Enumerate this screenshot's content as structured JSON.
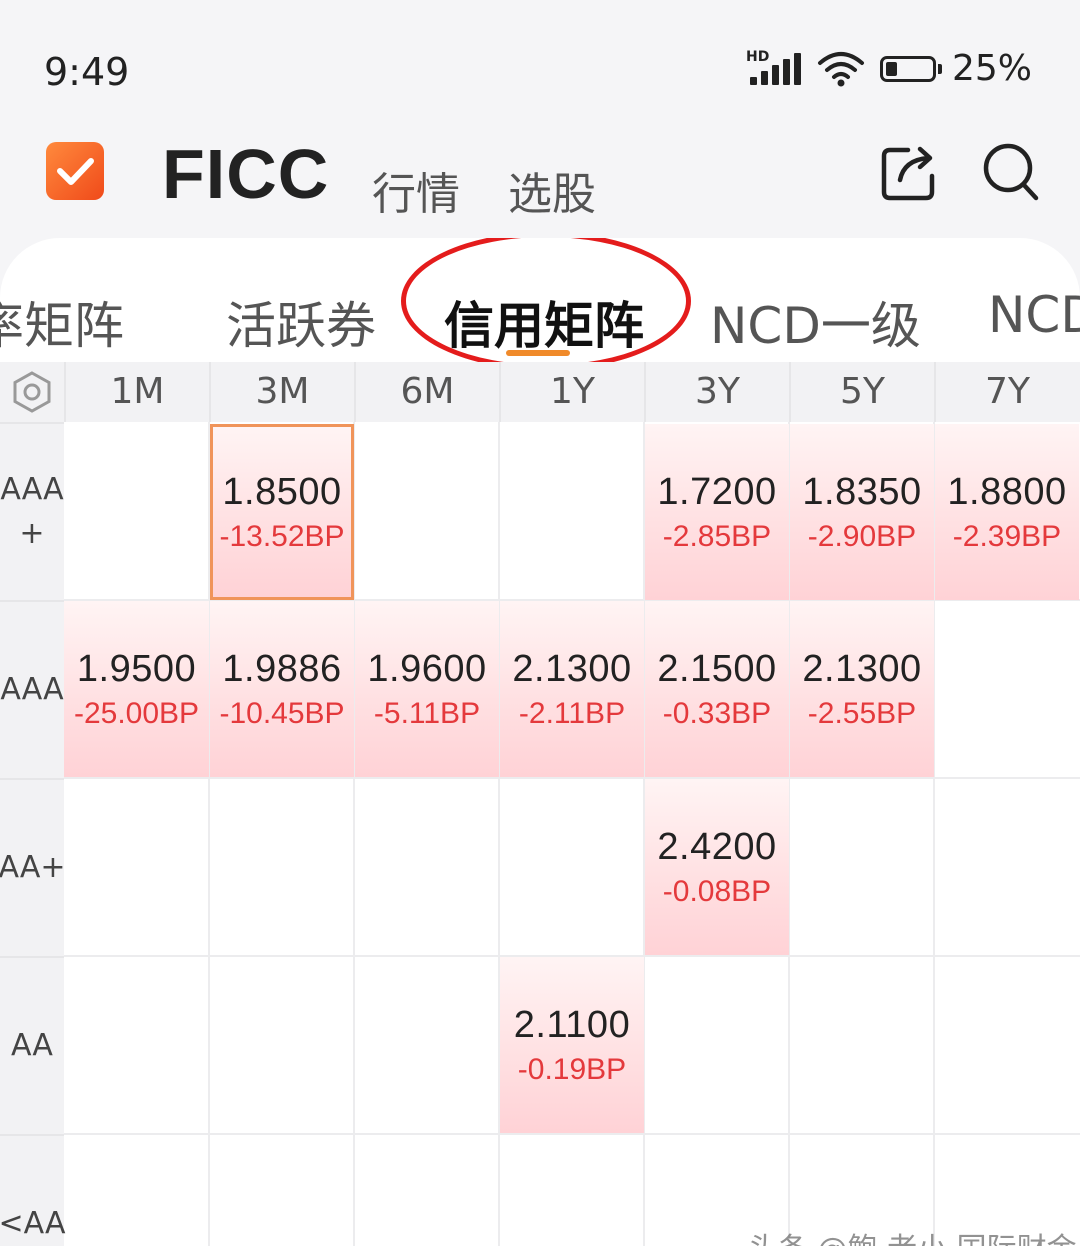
{
  "status_bar": {
    "time": "9:49",
    "network": "HD",
    "battery": "25%"
  },
  "header": {
    "title": "FICC",
    "nav": [
      "行情",
      "选股"
    ],
    "share_icon": "share-icon",
    "search_icon": "search-icon",
    "logo_icon": "checkmark-icon"
  },
  "tabs": [
    {
      "label": "率矩阵",
      "active": false
    },
    {
      "label": "活跃券",
      "active": false
    },
    {
      "label": "信用矩阵",
      "active": true
    },
    {
      "label": "NCD一级",
      "active": false
    },
    {
      "label": "NCD",
      "active": false
    }
  ],
  "matrix": {
    "settings_icon": "hexagon-settings-icon",
    "columns": [
      "1M",
      "3M",
      "6M",
      "1Y",
      "3Y",
      "5Y",
      "7Y"
    ],
    "rows": [
      {
        "label": "AAA+",
        "cells": [
          null,
          {
            "value": "1.8500",
            "change": "-13.52BP",
            "selected": true
          },
          null,
          null,
          {
            "value": "1.7200",
            "change": "-2.85BP"
          },
          {
            "value": "1.8350",
            "change": "-2.90BP"
          },
          {
            "value": "1.8800",
            "change": "-2.39BP"
          }
        ]
      },
      {
        "label": "AAA",
        "cells": [
          {
            "value": "1.9500",
            "change": "-25.00BP"
          },
          {
            "value": "1.9886",
            "change": "-10.45BP"
          },
          {
            "value": "1.9600",
            "change": "-5.11BP"
          },
          {
            "value": "2.1300",
            "change": "-2.11BP"
          },
          {
            "value": "2.1500",
            "change": "-0.33BP"
          },
          {
            "value": "2.1300",
            "change": "-2.55BP"
          },
          null
        ]
      },
      {
        "label": "AA+",
        "cells": [
          null,
          null,
          null,
          null,
          {
            "value": "2.4200",
            "change": "-0.08BP"
          },
          null,
          null
        ]
      },
      {
        "label": "AA",
        "cells": [
          null,
          null,
          null,
          {
            "value": "2.1100",
            "change": "-0.19BP"
          },
          null,
          null,
          null
        ]
      },
      {
        "label": "<AA",
        "cells": [
          null,
          null,
          null,
          null,
          null,
          null,
          null
        ]
      }
    ]
  },
  "colors": {
    "accent": "#f08a2a",
    "negative": "#e4393c",
    "annotation": "#e41c1c"
  },
  "watermark": "头条 @鲍 老小 国际财金"
}
